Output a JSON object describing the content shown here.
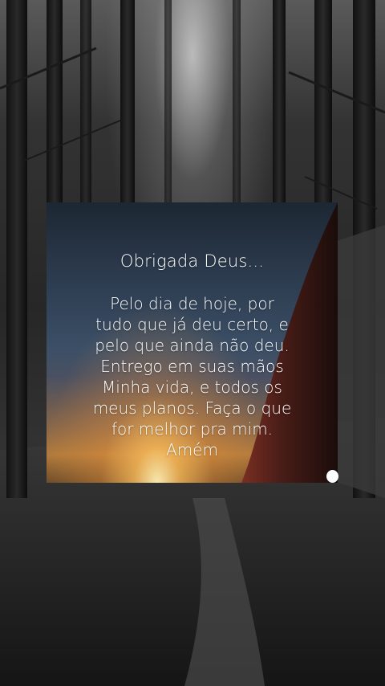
{
  "background": {
    "scene": "forest-path",
    "tone": "black-and-white"
  },
  "card": {
    "title": "Obrigada Deus...",
    "lines": [
      "Pelo dia de hoje, por",
      "tudo que já deu certo, e",
      "pelo que ainda não deu.",
      "Entrego em suas mãos",
      "Minha vida, e todos os",
      "meus planos. Faça o que",
      "for melhor pra mim.",
      "Amém"
    ],
    "colors": {
      "text": "#ffffff",
      "sun": "#ffd890",
      "sky": "#2e3e52"
    }
  }
}
